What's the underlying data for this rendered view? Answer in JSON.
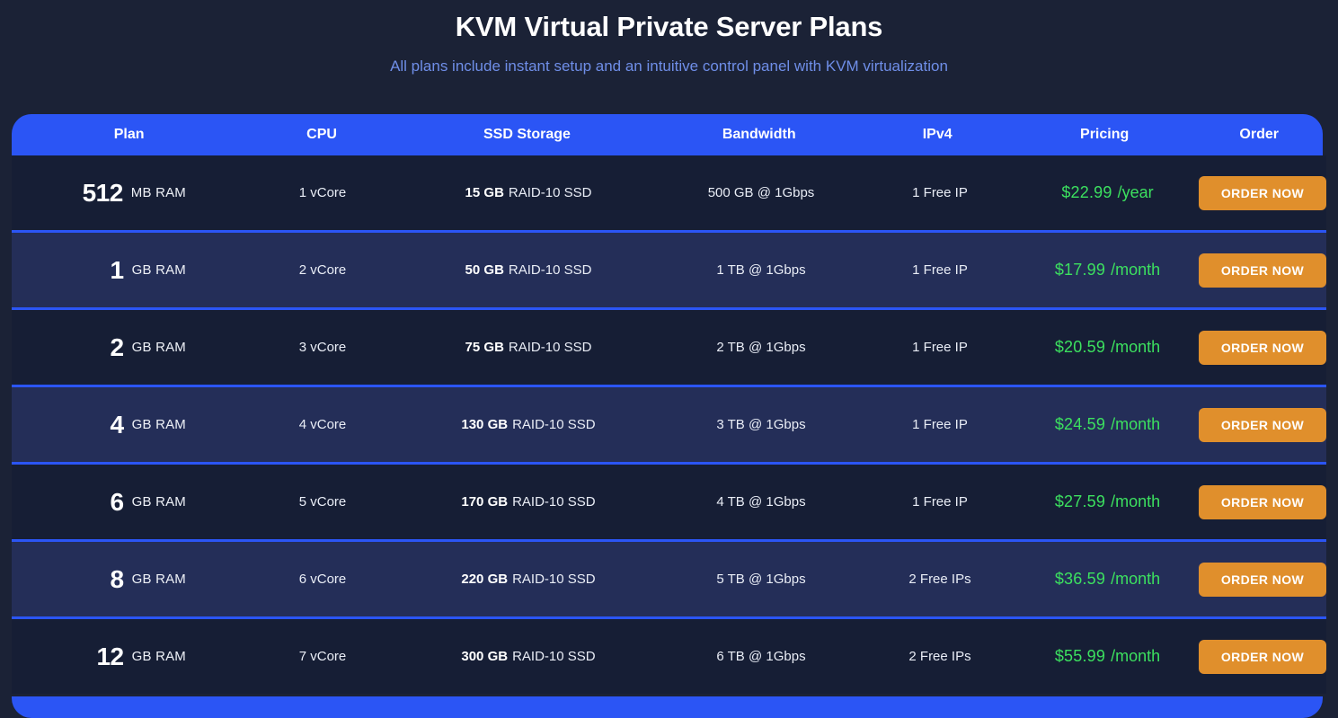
{
  "hero": {
    "title": "KVM Virtual Private Server Plans",
    "subtitle": "All plans include instant setup and an intuitive control panel with KVM virtualization"
  },
  "colors": {
    "page_background": "#1b2236",
    "header_blue": "#2b55f5",
    "row_dark": "#161e35",
    "row_light": "#242e58",
    "price_green": "#3ce05f",
    "order_orange": "#e08f2c",
    "subtitle_blue": "#6f8ee8"
  },
  "table": {
    "columns": [
      {
        "key": "plan",
        "label": "Plan"
      },
      {
        "key": "cpu",
        "label": "CPU"
      },
      {
        "key": "ssd",
        "label": "SSD Storage"
      },
      {
        "key": "bandwidth",
        "label": "Bandwidth"
      },
      {
        "key": "ipv4",
        "label": "IPv4"
      },
      {
        "key": "pricing",
        "label": "Pricing"
      },
      {
        "key": "order",
        "label": "Order"
      }
    ],
    "order_button_label": "ORDER NOW",
    "rows": [
      {
        "plan_number": "512",
        "plan_unit": "MB RAM",
        "cpu": "1 vCore",
        "ssd_size": "15 GB",
        "ssd_type": "RAID-10 SSD",
        "bandwidth": "500 GB @ 1Gbps",
        "ipv4": "1 Free IP",
        "price_amount": "$22.99",
        "price_period": "/year",
        "order": "ORDER NOW"
      },
      {
        "plan_number": "1",
        "plan_unit": "GB RAM",
        "cpu": "2 vCore",
        "ssd_size": "50 GB",
        "ssd_type": "RAID-10 SSD",
        "bandwidth": "1 TB @ 1Gbps",
        "ipv4": "1 Free IP",
        "price_amount": "$17.99",
        "price_period": "/month",
        "order": "ORDER NOW"
      },
      {
        "plan_number": "2",
        "plan_unit": "GB RAM",
        "cpu": "3 vCore",
        "ssd_size": "75 GB",
        "ssd_type": "RAID-10 SSD",
        "bandwidth": "2 TB @ 1Gbps",
        "ipv4": "1 Free IP",
        "price_amount": "$20.59",
        "price_period": "/month",
        "order": "ORDER NOW"
      },
      {
        "plan_number": "4",
        "plan_unit": "GB RAM",
        "cpu": "4 vCore",
        "ssd_size": "130 GB",
        "ssd_type": "RAID-10 SSD",
        "bandwidth": "3 TB @ 1Gbps",
        "ipv4": "1 Free IP",
        "price_amount": "$24.59",
        "price_period": "/month",
        "order": "ORDER NOW"
      },
      {
        "plan_number": "6",
        "plan_unit": "GB RAM",
        "cpu": "5 vCore",
        "ssd_size": "170 GB",
        "ssd_type": "RAID-10 SSD",
        "bandwidth": "4 TB @ 1Gbps",
        "ipv4": "1 Free IP",
        "price_amount": "$27.59",
        "price_period": "/month",
        "order": "ORDER NOW"
      },
      {
        "plan_number": "8",
        "plan_unit": "GB RAM",
        "cpu": "6 vCore",
        "ssd_size": "220 GB",
        "ssd_type": "RAID-10 SSD",
        "bandwidth": "5 TB @ 1Gbps",
        "ipv4": "2 Free IPs",
        "price_amount": "$36.59",
        "price_period": "/month",
        "order": "ORDER NOW"
      },
      {
        "plan_number": "12",
        "plan_unit": "GB RAM",
        "cpu": "7 vCore",
        "ssd_size": "300 GB",
        "ssd_type": "RAID-10 SSD",
        "bandwidth": "6 TB @ 1Gbps",
        "ipv4": "2 Free IPs",
        "price_amount": "$55.99",
        "price_period": "/month",
        "order": "ORDER NOW"
      }
    ]
  }
}
